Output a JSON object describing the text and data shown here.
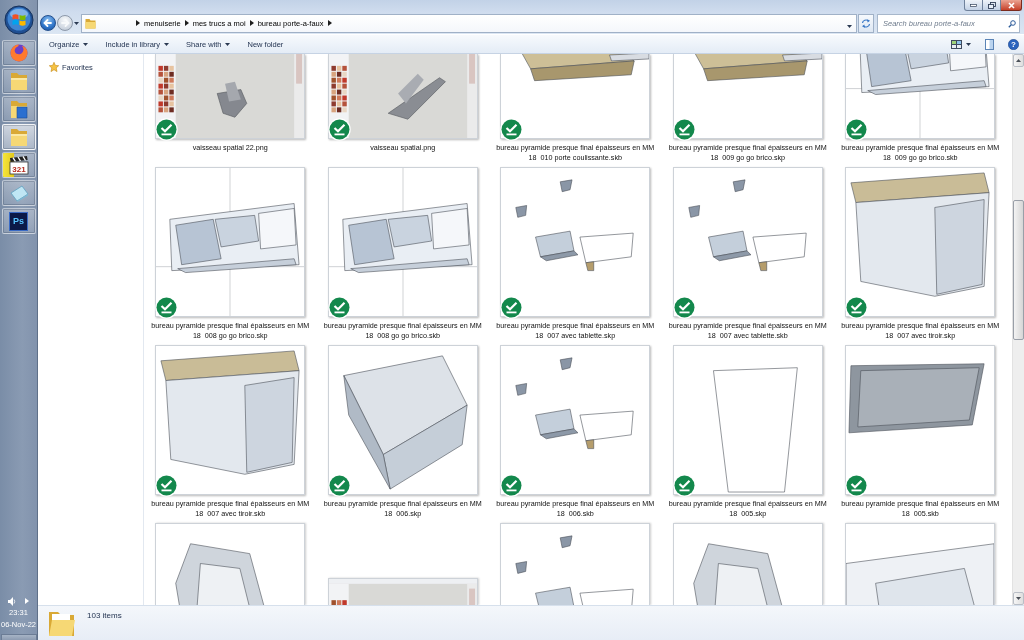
{
  "taskbar": {
    "items": [
      {
        "kind": "browser",
        "selected": false
      },
      {
        "kind": "folder",
        "selected": false
      },
      {
        "kind": "folder_document",
        "selected": false
      },
      {
        "kind": "folder",
        "selected": true
      },
      {
        "kind": "media",
        "text": "321",
        "selected": false,
        "progress": {
          "level": 0.36,
          "paused": true
        }
      },
      {
        "kind": "notes",
        "selected": false
      },
      {
        "kind": "photo_editor",
        "text": "Ps",
        "selected": false
      }
    ],
    "time": "23:31",
    "date": "06-Nov-22"
  },
  "address": {
    "nav_buttons": [
      {
        "kind": "back",
        "disabled": false
      },
      {
        "kind": "forward",
        "disabled": true
      }
    ],
    "breadcrumbs": [
      "menuiserie",
      "mes trucs a moi",
      "bureau porte-a-faux"
    ]
  },
  "search": {
    "placeholder": "Search bureau porte-a-faux"
  },
  "toolbar": {
    "commands": [
      {
        "label": "Organize",
        "dropdown": true
      },
      {
        "label": "Include in library",
        "dropdown": true
      },
      {
        "label": "Share with",
        "dropdown": true
      },
      {
        "label": "New folder",
        "dropdown": false
      }
    ],
    "help_glyph": "?"
  },
  "navigation": {
    "items": [
      {
        "label": "Favorites"
      }
    ]
  },
  "files": [
    {
      "name": "vaisseau spatial 22.png",
      "kind": "image",
      "synced": true
    },
    {
      "name": "vaisseau spatial.png",
      "kind": "image",
      "synced": true
    },
    {
      "name": "bureau pyramide presque final épaisseurs en MM 18  010 porte coulissante.skb",
      "kind": "model",
      "synced": true
    },
    {
      "name": "bureau pyramide presque final épaisseurs en MM 18  009 go go brico.skp",
      "kind": "model",
      "synced": true
    },
    {
      "name": "bureau pyramide presque final épaisseurs en MM 18  009 go go brico.skb",
      "kind": "model",
      "synced": true
    },
    {
      "name": "bureau pyramide presque final épaisseurs en MM 18  008 go go brico.skp",
      "kind": "model",
      "synced": true
    },
    {
      "name": "bureau pyramide presque final épaisseurs en MM 18  008 go go brico.skb",
      "kind": "model",
      "synced": true
    },
    {
      "name": "bureau pyramide presque final épaisseurs en MM 18  007 avec tablette.skp",
      "kind": "model",
      "synced": true
    },
    {
      "name": "bureau pyramide presque final épaisseurs en MM 18  007 avec tablette.skb",
      "kind": "model",
      "synced": true
    },
    {
      "name": "bureau pyramide presque final épaisseurs en MM 18  007 avec tiroir.skp",
      "kind": "model",
      "synced": true
    },
    {
      "name": "bureau pyramide presque final épaisseurs en MM 18  007 avec tiroir.skb",
      "kind": "model",
      "synced": true
    },
    {
      "name": "bureau pyramide presque final épaisseurs en MM 18  006.skp",
      "kind": "model",
      "synced": true
    },
    {
      "name": "bureau pyramide presque final épaisseurs en MM 18  006.skb",
      "kind": "model",
      "synced": true
    },
    {
      "name": "bureau pyramide presque final épaisseurs en MM 18  005.skp",
      "kind": "model",
      "synced": true
    },
    {
      "name": "bureau pyramide presque final épaisseurs en MM 18  005.skb",
      "kind": "model",
      "synced": true
    },
    {
      "kind": "model"
    },
    {
      "kind": "image"
    },
    {
      "kind": "model"
    },
    {
      "kind": "model"
    },
    {
      "kind": "model"
    }
  ],
  "status_bar": {
    "item_count": "103 items"
  }
}
